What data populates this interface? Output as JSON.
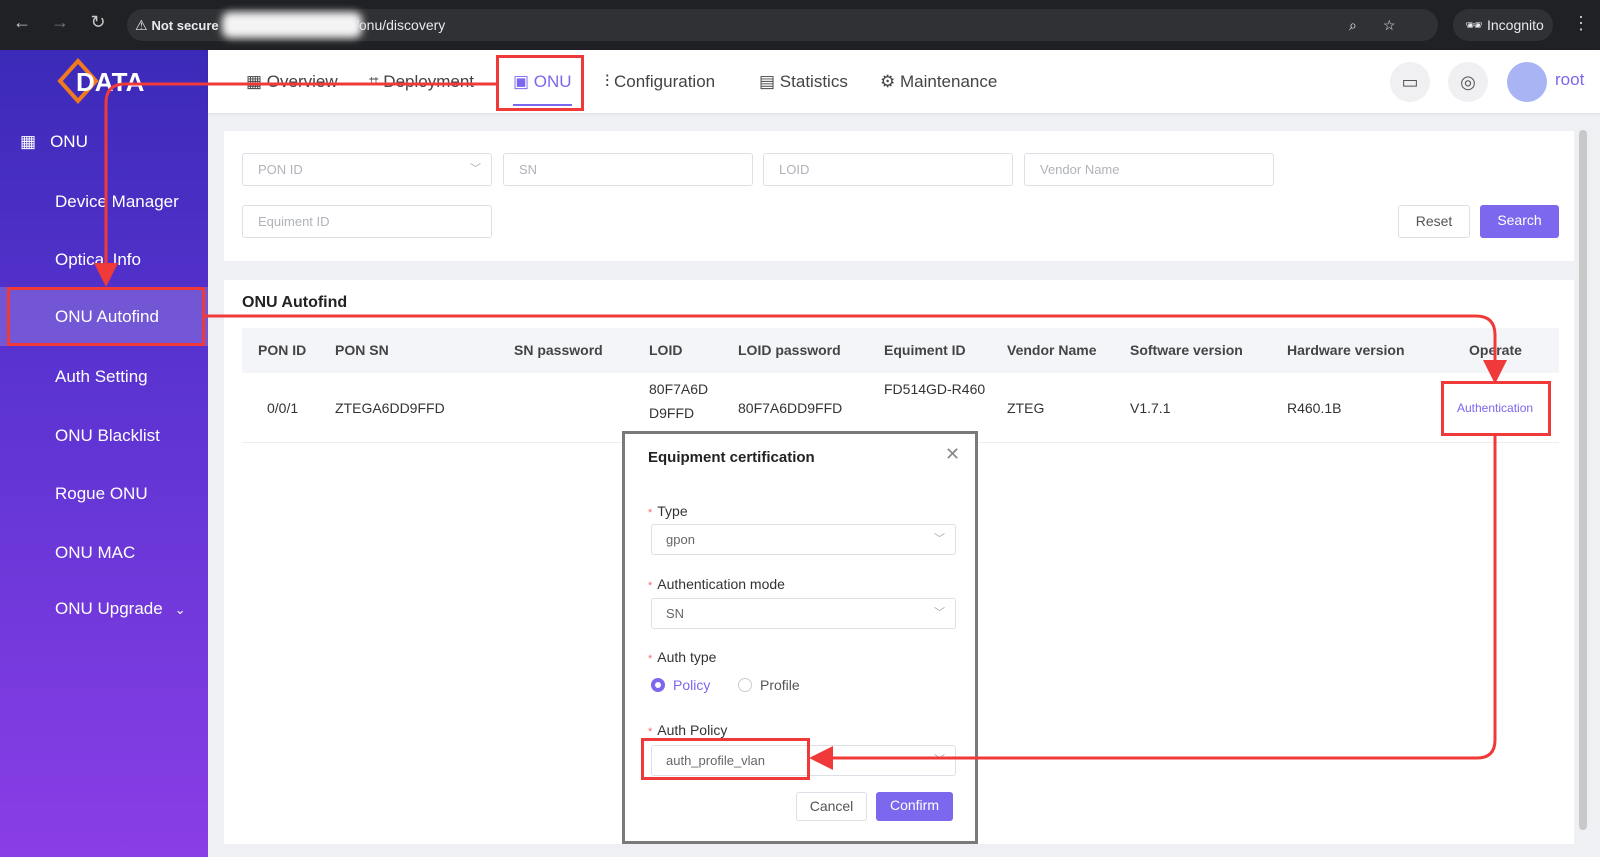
{
  "browser": {
    "security": "Not secure",
    "url": "/onu/discovery",
    "incognito": "Incognito"
  },
  "brand": {
    "logo": "DATA",
    "accent": "#7b68ee",
    "annotation": "#f03a3a"
  },
  "topnav": {
    "items": [
      {
        "label": "Overview",
        "icon": "grid-icon"
      },
      {
        "label": "Deployment",
        "icon": "topology-icon"
      },
      {
        "label": "ONU",
        "icon": "onu-icon"
      },
      {
        "label": "Configuration",
        "icon": "sliders-icon"
      },
      {
        "label": "Statistics",
        "icon": "window-icon"
      },
      {
        "label": "Maintenance",
        "icon": "gear-icon"
      }
    ],
    "active": "ONU",
    "user": "root"
  },
  "sidebar": {
    "section": "ONU",
    "items": [
      "Device Manager",
      "Optical Info",
      "ONU Autofind",
      "Auth Setting",
      "ONU Blacklist",
      "Rogue ONU",
      "ONU MAC",
      "ONU Upgrade"
    ],
    "active": "ONU Autofind"
  },
  "filters": {
    "pon_id_placeholder": "PON ID",
    "sn_placeholder": "SN",
    "loid_placeholder": "LOID",
    "vendor_placeholder": "Vendor Name",
    "equipment_placeholder": "Equiment ID",
    "reset": "Reset",
    "search": "Search"
  },
  "table": {
    "title": "ONU Autofind",
    "columns": [
      "PON ID",
      "PON SN",
      "SN password",
      "LOID",
      "LOID password",
      "Equiment ID",
      "Vendor Name",
      "Software version",
      "Hardware version",
      "Operate"
    ],
    "rows": [
      {
        "pon_id": "0/0/1",
        "pon_sn": "ZTEGA6DD9FFD",
        "sn_password": "",
        "loid": "80F7A6DD9FFD",
        "loid_password": "80F7A6DD9FFD",
        "equipment_id": "FD514GD-R460",
        "vendor": "ZTEG",
        "software": "V1.7.1",
        "hardware": "R460.1B",
        "operate": "Authentication"
      }
    ]
  },
  "modal": {
    "title": "Equipment certification",
    "type_label": "Type",
    "type_value": "gpon",
    "mode_label": "Authentication mode",
    "mode_value": "SN",
    "auth_type_label": "Auth type",
    "auth_type_options": [
      "Policy",
      "Profile"
    ],
    "auth_type_selected": "Policy",
    "policy_label": "Auth Policy",
    "policy_value": "auth_profile_vlan",
    "cancel": "Cancel",
    "confirm": "Confirm"
  }
}
